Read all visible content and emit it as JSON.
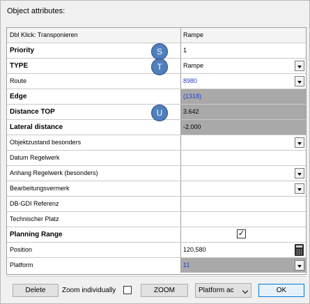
{
  "window": {
    "title": "Object attributes:"
  },
  "header": {
    "name": "Dbl Klick: Transponieren",
    "value": "Rampe"
  },
  "rows": [
    {
      "name": "Priority",
      "value": "1"
    },
    {
      "name": "TYPE",
      "value": "Rampe"
    },
    {
      "name": "Route",
      "value": "8980"
    },
    {
      "name": "Edge",
      "value": "(1318)"
    },
    {
      "name": "Distance TOP",
      "value": "3.642"
    },
    {
      "name": "Lateral distance",
      "value": "-2.000"
    },
    {
      "name": "Objektzustand besonders",
      "value": ""
    },
    {
      "name": "Datum Regelwerk",
      "value": ""
    },
    {
      "name": "Anhang Regelwerk (besonders)",
      "value": ""
    },
    {
      "name": "Bearbeitungsvermerk",
      "value": ""
    },
    {
      "name": "DB-GDI Referenz",
      "value": ""
    },
    {
      "name": "Technischer Platz",
      "value": ""
    },
    {
      "name": "Planning Range",
      "value": "✓"
    },
    {
      "name": "Position",
      "value": "120,580"
    },
    {
      "name": "Platform",
      "value": "11"
    }
  ],
  "badges": {
    "s": "S",
    "t": "T",
    "u": "U"
  },
  "footer": {
    "delete_label": "Delete",
    "zoom_individually_label": "Zoom individually",
    "zoom_label": "ZOOM",
    "platform_select_value": "Platform ac",
    "ok_label": "OK"
  },
  "colors": {
    "gray_cell": "#a9a9a9",
    "link_blue": "#1f3fcf",
    "badge_blue": "#4f7fbd",
    "ok_border": "#0078d7"
  },
  "icons": {
    "dropdown": "chevron-down-icon",
    "calculator": "calculator-icon",
    "checkmark": "checkmark-icon"
  }
}
